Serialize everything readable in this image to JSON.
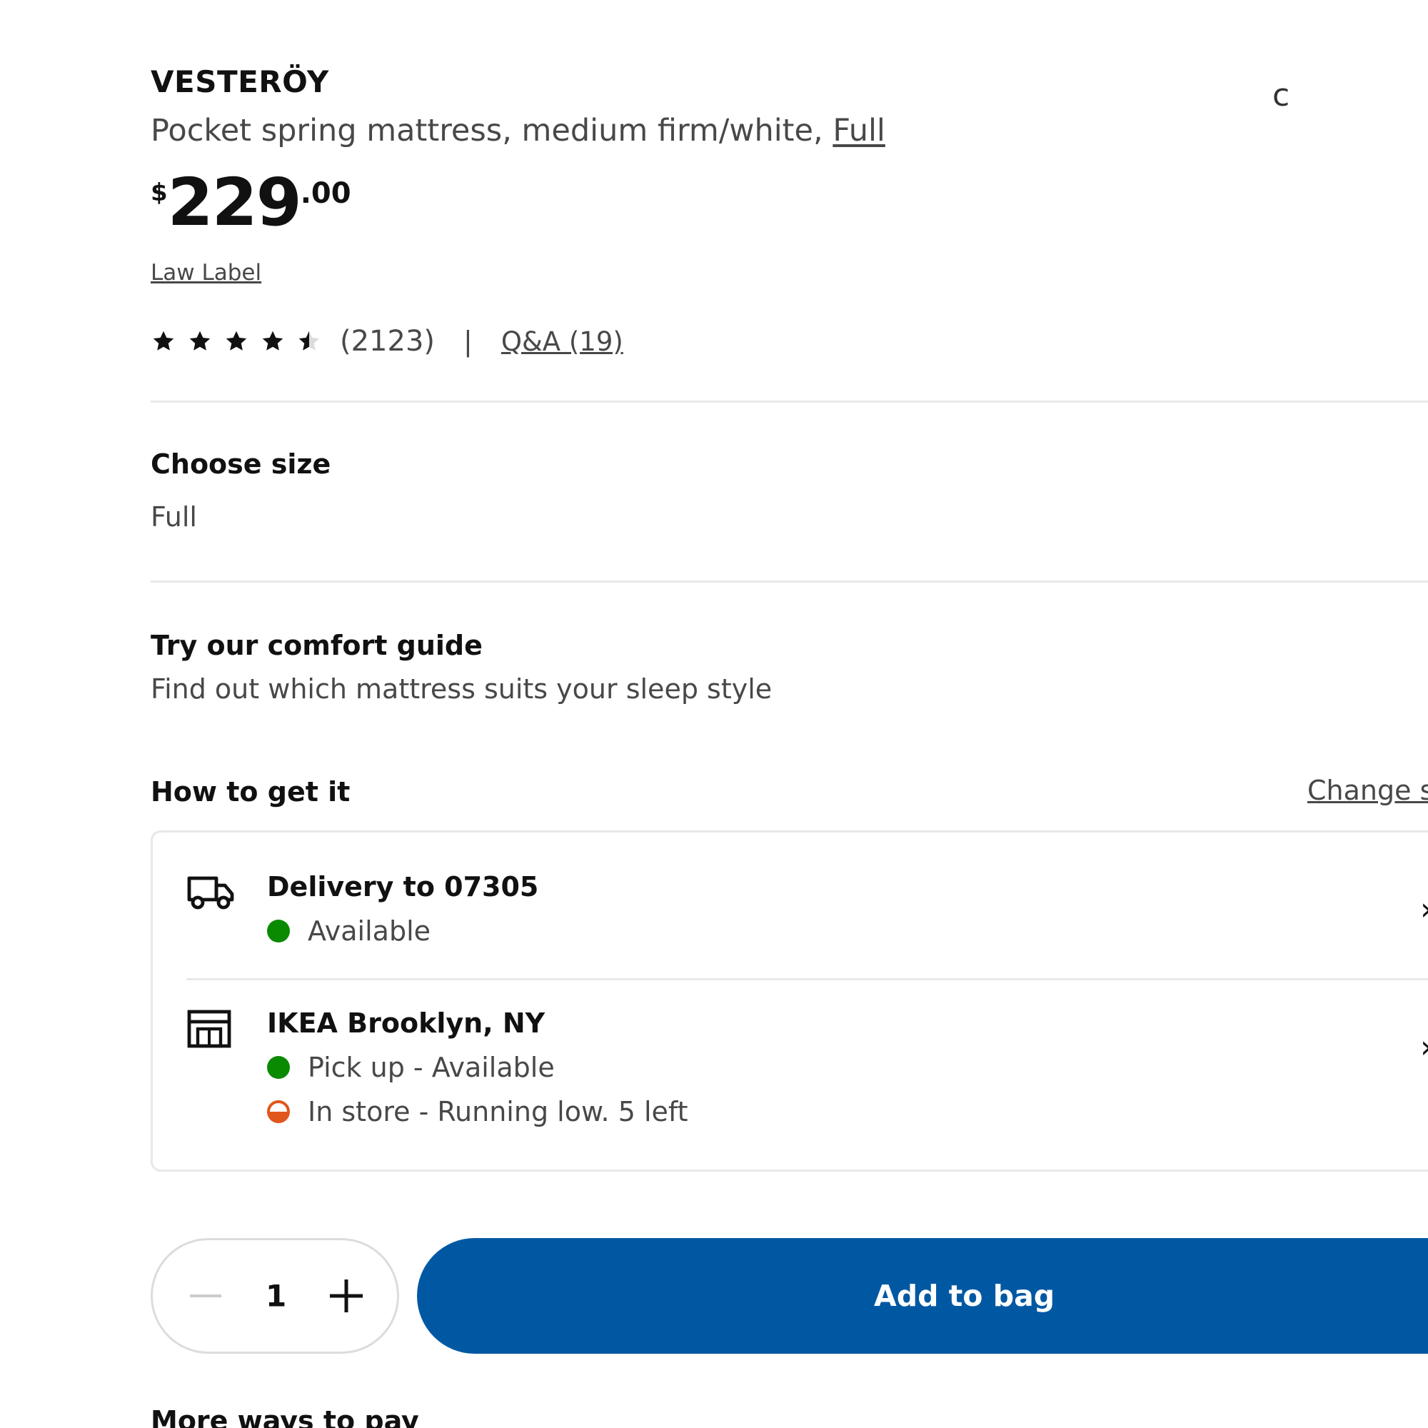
{
  "product": {
    "name": "VESTERÖY",
    "description_prefix": "Pocket spring mattress, medium firm/white,",
    "size_link": "Full",
    "price": {
      "currency": "$",
      "integer": "229",
      "decimal": ".00"
    },
    "law_label": "Law Label"
  },
  "rating": {
    "stars": 4.5,
    "count": "(2123)",
    "separator": "|",
    "qa_link": "Q&A (19)"
  },
  "size": {
    "heading": "Choose size",
    "selected": "Full"
  },
  "comfort_guide": {
    "heading": "Try our comfort guide",
    "text": "Find out which mattress suits your sleep style"
  },
  "how_to_get": {
    "heading": "How to get it",
    "change_link": "Change s",
    "delivery": {
      "icon": "truck-icon",
      "title": "Delivery to 07305",
      "status": "Available",
      "status_color": "#0a8a00"
    },
    "store": {
      "icon": "store-icon",
      "title": "IKEA Brooklyn, NY",
      "pickup_status": "Pick up - Available",
      "pickup_color": "#0a8a00",
      "instore_status": "In store - Running low. 5 left",
      "instore_color": "#e0571d"
    },
    "chevron": "›"
  },
  "purchase": {
    "quantity": "1",
    "add_to_bag": "Add to bag",
    "button_color": "#0058a3"
  },
  "more_ways": "More ways to pay",
  "edge_glyph": "c"
}
